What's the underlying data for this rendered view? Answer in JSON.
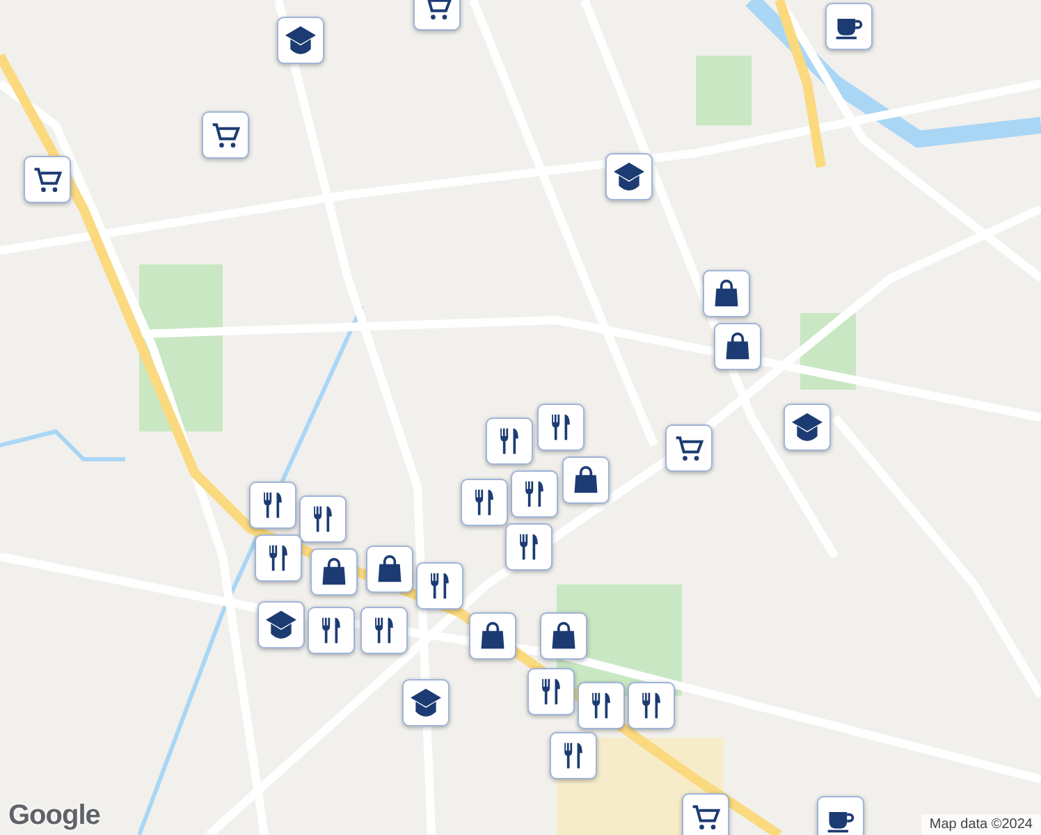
{
  "map": {
    "markers": [
      {
        "kind": "school"
      },
      {
        "kind": "cart"
      },
      {
        "kind": "cart"
      },
      {
        "kind": "cart"
      },
      {
        "kind": "cafe"
      },
      {
        "kind": "school"
      },
      {
        "kind": "bag"
      },
      {
        "kind": "bag"
      },
      {
        "kind": "food"
      },
      {
        "kind": "food"
      },
      {
        "kind": "bag"
      },
      {
        "kind": "food"
      },
      {
        "kind": "cart"
      },
      {
        "kind": "school"
      },
      {
        "kind": "food"
      },
      {
        "kind": "food"
      },
      {
        "kind": "food"
      },
      {
        "kind": "food"
      },
      {
        "kind": "food"
      },
      {
        "kind": "bag"
      },
      {
        "kind": "bag"
      },
      {
        "kind": "food"
      },
      {
        "kind": "school"
      },
      {
        "kind": "food"
      },
      {
        "kind": "food"
      },
      {
        "kind": "bag"
      },
      {
        "kind": "bag"
      },
      {
        "kind": "food"
      },
      {
        "kind": "food"
      },
      {
        "kind": "food"
      },
      {
        "kind": "food"
      },
      {
        "kind": "school"
      },
      {
        "kind": "cart"
      },
      {
        "kind": "cafe"
      }
    ],
    "logo": "Google",
    "attribution": "Map data ©2024"
  }
}
